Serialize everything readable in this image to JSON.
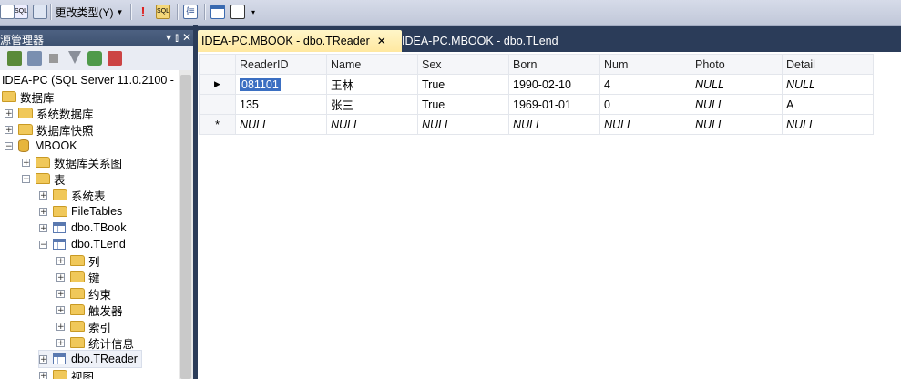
{
  "toolbar": {
    "change_type_label": "更改类型(Y)",
    "icons": [
      "grid-icon",
      "sql-pane-icon",
      "results-pane-icon",
      "execute-sql-icon",
      "verify-sql-icon",
      "group-by-icon",
      "add-table-icon",
      "add-derived-table-icon",
      "toolbar-options-icon"
    ]
  },
  "explorer": {
    "title": "源管理器",
    "pin_label": "▾ ⫾ ✕",
    "nodes": {
      "server": "IDEA-PC (SQL Server 11.0.2100 -",
      "databases": "数据库",
      "system_db": "系统数据库",
      "db_snapshots": "数据库快照",
      "mbook": "MBOOK",
      "diagrams": "数据库关系图",
      "tables": "表",
      "system_tables": "系统表",
      "filetables": "FileTables",
      "tbook": "dbo.TBook",
      "tlend": "dbo.TLend",
      "columns": "列",
      "keys": "键",
      "constraints": "约束",
      "triggers": "触发器",
      "indexes": "索引",
      "statistics": "统计信息",
      "treader": "dbo.TReader",
      "views": "视图"
    }
  },
  "tabs": {
    "active": "IDEA-PC.MBOOK - dbo.TReader",
    "inactive": "IDEA-PC.MBOOK - dbo.TLend",
    "close": "✕"
  },
  "grid": {
    "columns": [
      "ReaderID",
      "Name",
      "Sex",
      "Born",
      "Num",
      "Photo",
      "Detail"
    ],
    "rows": [
      [
        "081101",
        "王林",
        "True",
        "1990-02-10",
        "4",
        "NULL",
        "NULL"
      ],
      [
        "135",
        "张三",
        "True",
        "1969-01-01",
        "0",
        "NULL",
        "A"
      ],
      [
        "NULL",
        "NULL",
        "NULL",
        "NULL",
        "NULL",
        "NULL",
        "NULL"
      ]
    ],
    "row_markers": [
      "▶",
      "",
      "*"
    ],
    "colors": {
      "selection": "#3b6fc2",
      "tab_active": "#ffe8a0",
      "frame": "#2b3c59"
    }
  }
}
